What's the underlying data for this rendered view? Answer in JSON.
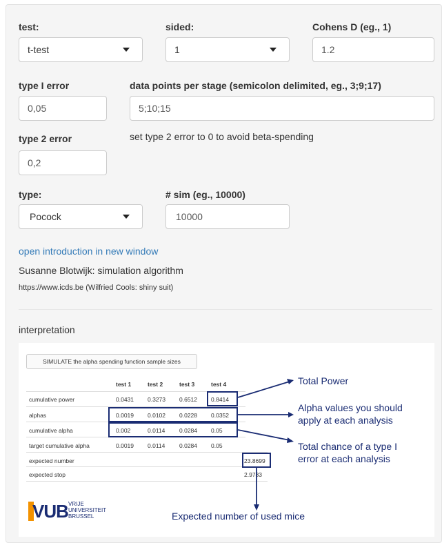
{
  "form": {
    "test_label": "test:",
    "test_value": "t-test",
    "sided_label": "sided:",
    "sided_value": "1",
    "cohens_label": "Cohens D (eg., 1)",
    "cohens_value": "1.2",
    "type1_label": "type I error",
    "type1_value": "0,05",
    "datapoints_label": "data points per stage (semicolon delimited, eg., 3;9;17)",
    "datapoints_value": "5;10;15",
    "type2_label": "type 2 error",
    "type2_value": "0,2",
    "type2_note": "set type 2 error to 0 to avoid beta-spending",
    "type_label": "type:",
    "type_value": "Pocock",
    "nsim_label": "# sim (eg., 10000)",
    "nsim_value": "10000"
  },
  "links": {
    "intro_link": "open introduction in new window",
    "credit1": "Susanne Blotwijk: simulation algorithm",
    "credit2": "https://www.icds.be (Wilfried Cools: shiny suit)"
  },
  "interpretation": {
    "heading": "interpretation",
    "simulate_button": "SIMULATE the alpha spending function sample sizes",
    "columns": [
      "test 1",
      "test 2",
      "test 3",
      "test 4"
    ],
    "rows": [
      {
        "label": "cumulative power",
        "values": [
          "0.0431",
          "0.3273",
          "0.6512",
          "0.8414"
        ]
      },
      {
        "label": "alphas",
        "values": [
          "0.0019",
          "0.0102",
          "0.0228",
          "0.0352"
        ]
      },
      {
        "label": "cumulative alpha",
        "values": [
          "0.002",
          "0.0114",
          "0.0284",
          "0.05"
        ]
      },
      {
        "label": "target cumulative alpha",
        "values": [
          "0.0019",
          "0.0114",
          "0.0284",
          "0.05"
        ]
      },
      {
        "label": "expected number",
        "values": [
          "",
          "",
          "",
          "23.8699"
        ]
      },
      {
        "label": "expected stop",
        "values": [
          "",
          "",
          "",
          "2.9783"
        ]
      }
    ],
    "annotations": {
      "total_power": "Total Power",
      "alpha_values_1": "Alpha values you should",
      "alpha_values_2": "apply at each analysis",
      "type1_chance_1": "Total chance of a type I",
      "type1_chance_2": "error at each analysis",
      "expected_mice": "Expected number of used mice"
    },
    "logo": {
      "mark": "VUB",
      "line1": "VRIJE",
      "line2": "UNIVERSITEIT",
      "line3": "BRUSSEL"
    }
  },
  "colors": {
    "annotation": "#1a2c73",
    "link": "#337ab7",
    "vub_orange": "#f39200",
    "vub_blue": "#1a2c73"
  }
}
